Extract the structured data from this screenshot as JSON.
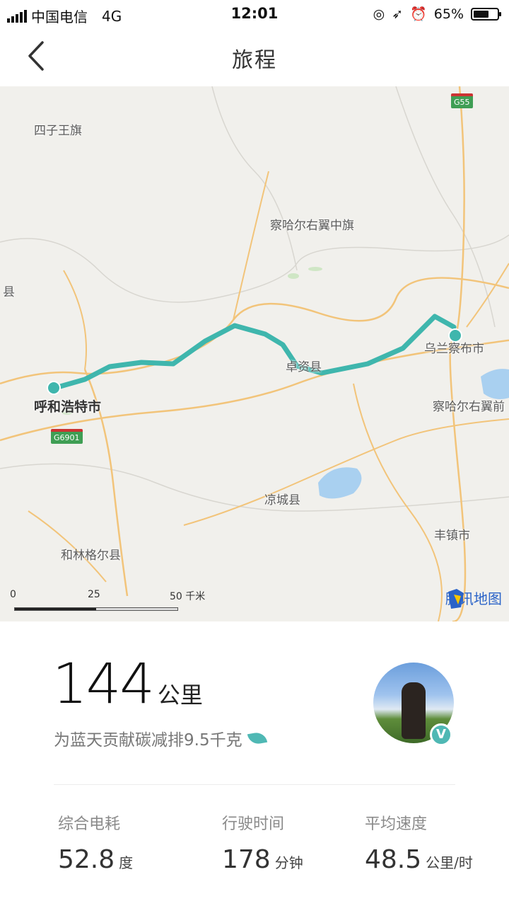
{
  "status_bar": {
    "carrier": "中国电信",
    "network": "4G",
    "time": "12:01",
    "battery_percent": "65%",
    "battery_level": 0.65
  },
  "nav": {
    "title": "旅程"
  },
  "map": {
    "places": {
      "siziwang": "四子王旗",
      "chahaer_zhong": "察哈尔右翼中旗",
      "left_edge": "县",
      "ulanqab": "乌兰察布市",
      "zhuozi": "卓资县",
      "hohhot": "呼和浩特市",
      "chahaer_qian": "察哈尔右翼前",
      "liangcheng": "凉城县",
      "fengzhen": "丰镇市",
      "horinger": "和林格尔县"
    },
    "highway_shields": {
      "g55": "G55",
      "g6": "G6901"
    },
    "scale": {
      "tick_0": "0",
      "tick_25": "25",
      "tick_50": "50 千米"
    },
    "provider": "腾讯地图",
    "colors": {
      "route": "#3fb6ad",
      "water": "#a9d0f0",
      "road": "#f2c47a",
      "background": "#f1f0ec"
    }
  },
  "trip": {
    "distance_value": "144",
    "distance_unit": "公里",
    "carbon_text": "为蓝天贡献碳减排9.5千克",
    "avatar_badge": "V"
  },
  "stats": {
    "energy": {
      "label": "综合电耗",
      "value": "52.8",
      "unit": "度"
    },
    "duration": {
      "label": "行驶时间",
      "value": "178",
      "unit": "分钟"
    },
    "speed": {
      "label": "平均速度",
      "value": "48.5",
      "unit": "公里/时"
    }
  }
}
